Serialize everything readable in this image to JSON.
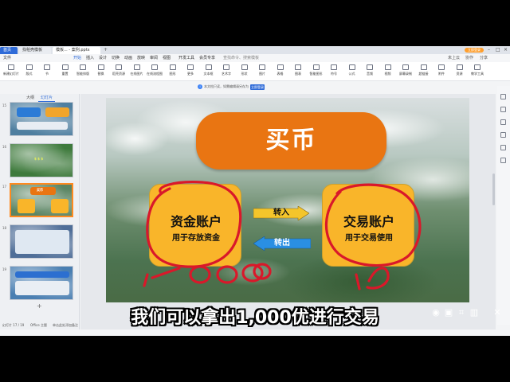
{
  "tabs": [
    {
      "label": "首页"
    },
    {
      "label": "找稻壳模板"
    },
    {
      "label": "模板... - 案例.pptx"
    }
  ],
  "window": {
    "login": "立即登录"
  },
  "menu": {
    "items": [
      "文件",
      "开始",
      "插入",
      "设计",
      "切换",
      "动画",
      "放映",
      "审阅",
      "视图",
      "开发工具",
      "会员专享"
    ],
    "search_placeholder": "查找命令、搜索模板",
    "right": [
      "未上云",
      "协作",
      "分享"
    ]
  },
  "ribbon": {
    "buttons": [
      "新建幻灯片",
      "版式",
      "节",
      "重置",
      "智能排版",
      "替换",
      "稻壳资源",
      "在线图片",
      "在线流程图",
      "图形",
      "更多",
      "文本框",
      "艺术字",
      "形状",
      "图片",
      "表格",
      "图表",
      "智能图形",
      "符号",
      "公式",
      "音频",
      "视频",
      "屏幕录制",
      "超链接",
      "附件",
      "资源",
      "教学工具"
    ]
  },
  "notice": {
    "text": "本文档只读，如需编辑请另存为",
    "button": "立即登录"
  },
  "thumbs": {
    "tabs": [
      "大纲",
      "幻灯片"
    ],
    "slide_titles": [
      "",
      "",
      "买币",
      "",
      ""
    ],
    "numbers": [
      "15",
      "16",
      "17",
      "18",
      "19"
    ],
    "status": "幻灯片 17 / 19",
    "theme": "Office 主题",
    "notes": "单击此处添加备注"
  },
  "slide": {
    "title": "买币",
    "left_account": {
      "main": "资金账户",
      "sub": "用于存放资金"
    },
    "right_account": {
      "main": "交易账户",
      "sub": "用于交易使用"
    },
    "arrow_in": "转入",
    "arrow_out": "转出",
    "colors": {
      "title_bg": "#e97512",
      "account_bg": "#f9b52a",
      "arrow_in": "#f4c52b",
      "arrow_out": "#2a8fe3",
      "ink": "#d9182a"
    }
  },
  "subtitle": "我们可以拿出1,000优进行交易"
}
